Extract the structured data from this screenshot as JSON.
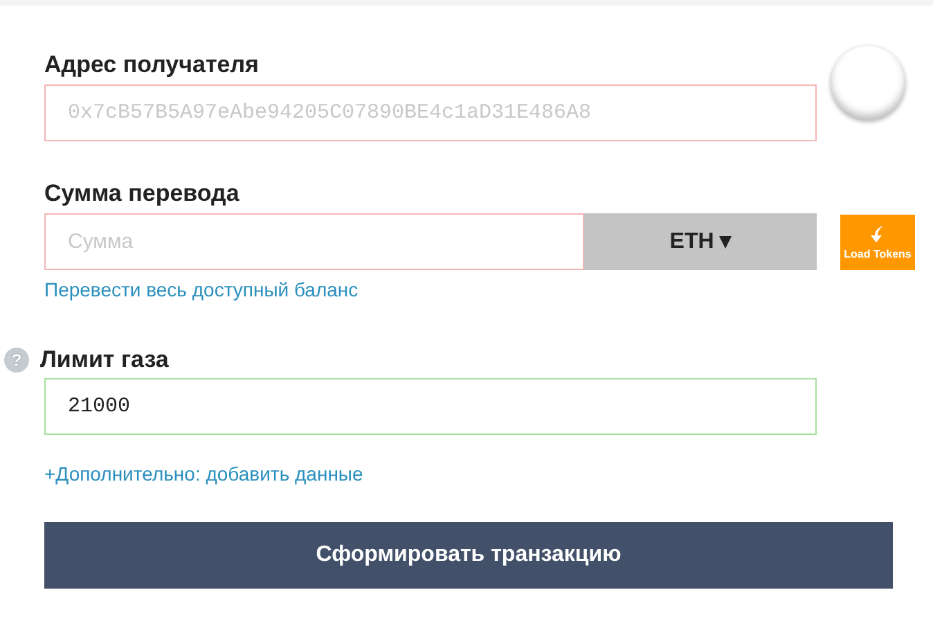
{
  "recipient": {
    "label": "Адрес получателя",
    "placeholder": "0x7cB57B5A97eAbe94205C07890BE4c1aD31E486A8",
    "valid": false
  },
  "amount": {
    "label": "Сумма перевода",
    "placeholder": "Сумма",
    "valid": false,
    "currency": "ETH ▾",
    "load_tokens": "Load Tokens",
    "send_all_link": "Перевести весь доступный баланс"
  },
  "gas": {
    "help": "?",
    "label": "Лимит газа",
    "value": "21000",
    "valid": true
  },
  "advanced_link": "+Дополнительно: добавить данные",
  "submit_button": "Сформировать транзакцию"
}
